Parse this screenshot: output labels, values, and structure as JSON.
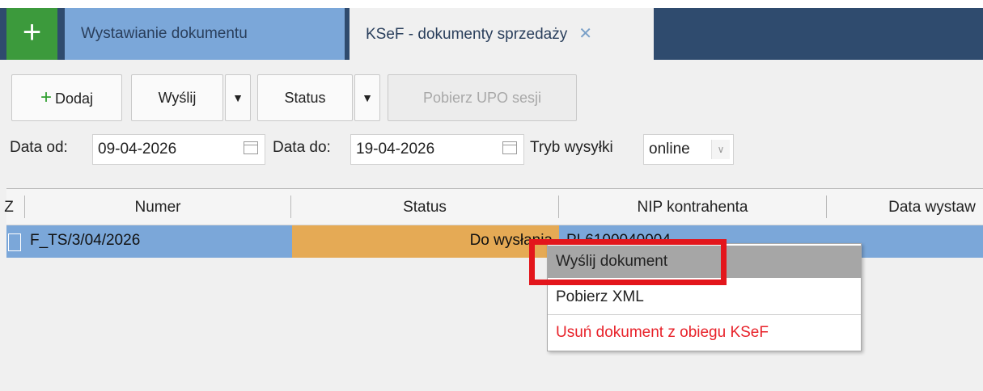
{
  "tabs": {
    "add_glyph": "+",
    "inactive_label": "Wystawianie dokumentu",
    "active_label": "KSeF - dokumenty sprzedaży",
    "close_glyph": "✕"
  },
  "toolbar": {
    "add_label": "Dodaj",
    "add_glyph": "+",
    "send_label": "Wyślij",
    "dropdown_glyph": "▼",
    "status_label": "Status",
    "upo_label": "Pobierz UPO sesji"
  },
  "filters": {
    "date_from_label": "Data od:",
    "date_from_value": "09-04-2026",
    "date_to_label": "Data do:",
    "date_to_value": "19-04-2026",
    "mode_label": "Tryb wysyłki",
    "mode_value": "online",
    "select_glyph": "∨"
  },
  "grid": {
    "columns": [
      "Z",
      "Numer",
      "Status",
      "NIP kontrahenta",
      "Data wystaw"
    ],
    "rows": [
      {
        "numer": "F_TS/3/04/2026",
        "status": "Do wysłania",
        "nip": "PL6100040004"
      }
    ],
    "status_color": "#e5aa55",
    "selected_row_color": "#7ba7d9"
  },
  "context_menu": {
    "items": [
      "Wyślij dokument",
      "Pobierz XML",
      "Usuń dokument z obiegu KSeF"
    ],
    "danger_color": "#e8222a",
    "highlight_color": "#e3161c"
  },
  "colors": {
    "tabbar": "#2f4b6e",
    "add_tab": "#3c9a3c",
    "inactive_tab": "#7ba7d9"
  }
}
